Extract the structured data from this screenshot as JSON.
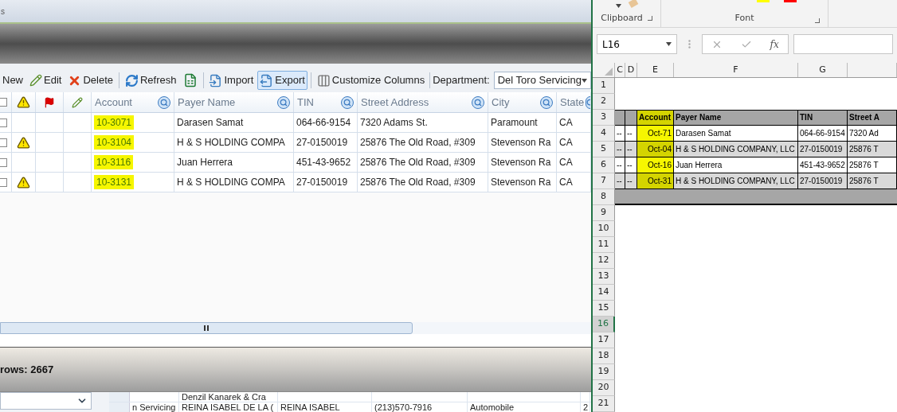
{
  "app": {
    "title_fragment": "s",
    "toolbar": [
      {
        "kind": "new",
        "label": "New",
        "pressed": false
      },
      {
        "kind": "edit",
        "label": "Edit",
        "pressed": false
      },
      {
        "kind": "delete",
        "label": "Delete",
        "pressed": false
      },
      {
        "kind": "refresh",
        "label": "Refresh",
        "pressed": false
      },
      {
        "kind": "excel",
        "pressed": false
      },
      {
        "kind": "import",
        "label": "Import",
        "pressed": false
      },
      {
        "kind": "export",
        "label": "Export",
        "pressed": true
      },
      {
        "kind": "columns",
        "label": "Customize Columns",
        "pressed": false
      }
    ],
    "department": {
      "label": "Department:",
      "value": "Del Toro Servicing"
    },
    "header_checkbox": {
      "checked": false
    },
    "columns": [
      "Account",
      "Payer Name",
      "TIN",
      "Street Address",
      "City",
      "State"
    ],
    "rows": [
      {
        "checked": false,
        "warning": false,
        "highlight": true,
        "cells": [
          "10-3071",
          "Darasen Samat",
          "064-66-9154",
          "7320 Adams St.",
          "Paramount",
          "CA"
        ]
      },
      {
        "checked": false,
        "warning": true,
        "highlight": true,
        "cells": [
          "10-3104",
          "H & S HOLDING COMPA",
          "27-0150019",
          "25876 The Old Road, #309",
          "Stevenson Ra",
          "CA"
        ]
      },
      {
        "checked": false,
        "warning": false,
        "highlight": true,
        "cells": [
          "10-3116",
          "Juan Herrera",
          "451-43-9652",
          "25876 The Old Road, #309",
          "Stevenson Ra",
          "CA"
        ]
      },
      {
        "checked": false,
        "warning": true,
        "highlight": true,
        "cells": [
          "10-3131",
          "H & S HOLDING COMPA",
          "27-0150019",
          "25876 The Old Road, #309",
          "Stevenson Ra",
          "CA"
        ]
      }
    ],
    "status": "rows: 2667",
    "lower_rows": [
      {
        "cells": [
          null,
          "Denzil Kanarek & Cra",
          null,
          null,
          null,
          null
        ]
      },
      {
        "cells": [
          "n Servicing",
          "REINA ISABEL DE LA (",
          "REINA ISABEL",
          "(213)570-7916",
          "Automobile",
          "2"
        ]
      }
    ]
  },
  "excel": {
    "groups": [
      "Clipboard",
      "Font"
    ],
    "name_box": "L16",
    "fx": "fx",
    "columns": [
      {
        "label": "C"
      },
      {
        "label": "D"
      },
      {
        "label": "E"
      },
      {
        "label": "F"
      },
      {
        "label": "G"
      }
    ],
    "rows": [
      {
        "number": "1",
        "selected": false,
        "kind": "blank"
      },
      {
        "number": "2",
        "selected": false,
        "kind": "blank"
      },
      {
        "number": "3",
        "selected": false,
        "kind": "header",
        "highlight": true,
        "cells": [
          "Account",
          "Payer Name",
          "TIN",
          "Street A"
        ]
      },
      {
        "number": "4",
        "selected": false,
        "kind": "data",
        "shaded": false,
        "highlight": true,
        "cells": [
          "--",
          "--",
          "Oct-71",
          "Darasen Samat",
          "064-66-9154",
          "7320 Ad"
        ]
      },
      {
        "number": "5",
        "selected": false,
        "kind": "data",
        "shaded": true,
        "highlight": true,
        "cells": [
          "--",
          "--",
          "Oct-04",
          "H & S HOLDING COMPANY, LLC",
          "27-0150019",
          "25876 T"
        ]
      },
      {
        "number": "6",
        "selected": false,
        "kind": "data",
        "shaded": false,
        "highlight": true,
        "cells": [
          "--",
          "--",
          "Oct-16",
          "Juan Herrera",
          "451-43-9652",
          "25876 T"
        ]
      },
      {
        "number": "7",
        "selected": false,
        "kind": "data",
        "shaded": true,
        "highlight": true,
        "cells": [
          "--",
          "--",
          "Oct-31",
          "H & S HOLDING COMPANY, LLC",
          "27-0150019",
          "25876 T"
        ]
      },
      {
        "number": "8",
        "selected": false,
        "kind": "band"
      },
      {
        "number": "9",
        "selected": false,
        "kind": "empty"
      },
      {
        "number": "10",
        "selected": false,
        "kind": "empty"
      },
      {
        "number": "11",
        "selected": false,
        "kind": "empty"
      },
      {
        "number": "12",
        "selected": false,
        "kind": "empty"
      },
      {
        "number": "13",
        "selected": false,
        "kind": "empty"
      },
      {
        "number": "14",
        "selected": false,
        "kind": "empty"
      },
      {
        "number": "15",
        "selected": false,
        "kind": "empty"
      },
      {
        "number": "16",
        "selected": true,
        "kind": "empty"
      },
      {
        "number": "17",
        "selected": false,
        "kind": "empty"
      },
      {
        "number": "18",
        "selected": false,
        "kind": "empty"
      },
      {
        "number": "19",
        "selected": false,
        "kind": "empty"
      },
      {
        "number": "20",
        "selected": false,
        "kind": "empty"
      },
      {
        "number": "21",
        "selected": false,
        "kind": "empty"
      }
    ]
  }
}
